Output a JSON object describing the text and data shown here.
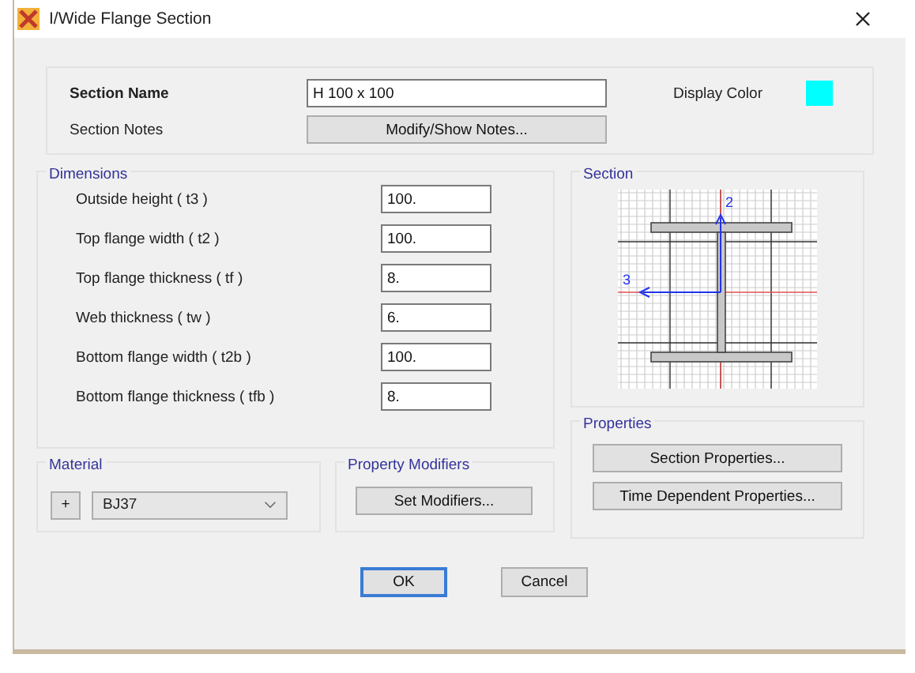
{
  "window": {
    "title": "I/Wide Flange Section"
  },
  "section_name": {
    "label": "Section Name",
    "value": "H 100 x 100"
  },
  "display_color": {
    "label": "Display Color",
    "color": "#00ffff"
  },
  "section_notes": {
    "label": "Section Notes",
    "button": "Modify/Show Notes..."
  },
  "dimensions": {
    "title": "Dimensions",
    "fields": [
      {
        "label": "Outside height  ( t3 )",
        "value": "100."
      },
      {
        "label": "Top flange width  ( t2 )",
        "value": "100."
      },
      {
        "label": "Top flange thickness  ( tf )",
        "value": "8."
      },
      {
        "label": "Web thickness  ( tw )",
        "value": "6."
      },
      {
        "label": "Bottom flange width  ( t2b )",
        "value": "100."
      },
      {
        "label": "Bottom flange thickness  ( tfb )",
        "value": "8."
      }
    ]
  },
  "section": {
    "title": "Section",
    "axis_vertical": "2",
    "axis_horizontal": "3"
  },
  "properties": {
    "title": "Properties",
    "buttons": [
      "Section Properties...",
      "Time Dependent Properties..."
    ]
  },
  "material": {
    "title": "Material",
    "add_button": "+",
    "value": "BJ37"
  },
  "property_modifiers": {
    "title": "Property Modifiers",
    "button": "Set Modifiers..."
  },
  "buttons": [
    {
      "label": "OK",
      "focused": true
    },
    {
      "label": "Cancel",
      "focused": false
    }
  ]
}
